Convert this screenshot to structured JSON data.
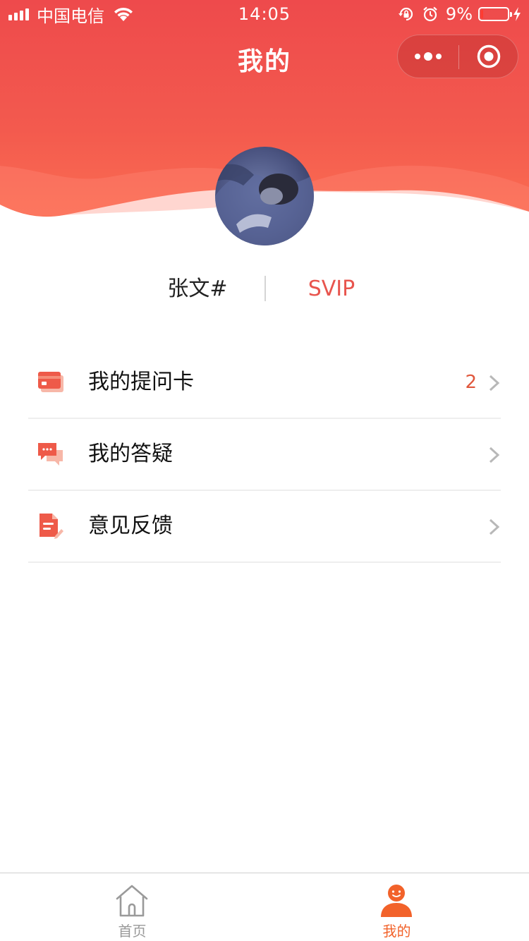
{
  "status_bar": {
    "carrier": "中国电信",
    "time": "14:05",
    "battery_percent": "9%",
    "battery_level": 0.09
  },
  "nav": {
    "title": "我的"
  },
  "user": {
    "name": "张文#",
    "level": "SVIP"
  },
  "menu": {
    "items": [
      {
        "label": "我的提问卡",
        "count": "2",
        "icon": "card-icon"
      },
      {
        "label": "我的答疑",
        "count": "",
        "icon": "chat-bubbles-icon"
      },
      {
        "label": "意见反馈",
        "count": "",
        "icon": "feedback-document-icon"
      }
    ]
  },
  "tabbar": {
    "items": [
      {
        "label": "首页",
        "icon": "home-icon",
        "active": false
      },
      {
        "label": "我的",
        "icon": "user-icon",
        "active": true
      }
    ]
  },
  "colors": {
    "header_gradient_top": "#ee4a4c",
    "header_gradient_bottom": "#fb6d52",
    "accent": "#f2622a",
    "level_text": "#e8554e",
    "count_text": "#e0573c",
    "tab_inactive": "#999999"
  }
}
